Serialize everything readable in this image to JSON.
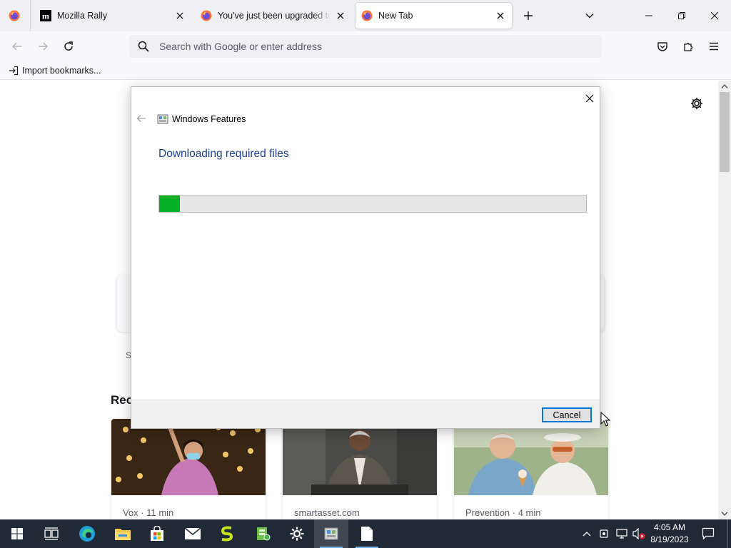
{
  "browser": {
    "tabs": [
      {
        "title": "Mozilla Rally",
        "favicon": "mozilla-m-icon",
        "active": false
      },
      {
        "title": "You've just been upgraded to F",
        "favicon": "firefox-icon",
        "active": false
      },
      {
        "title": "New Tab",
        "favicon": "firefox-icon",
        "active": true
      }
    ],
    "urlbar": {
      "placeholder": "Search with Google or enter address",
      "value": ""
    },
    "bookmarks": {
      "import_label": "Import bookmarks..."
    }
  },
  "newtab": {
    "recent_heading": "Rec",
    "partial_label": "S",
    "cards": [
      {
        "source": "Vox · 11 min",
        "image": "woman-in-mask-taking-photo"
      },
      {
        "source": "smartasset.com",
        "image": "elderly-man-in-suit"
      },
      {
        "source": "Prevention · 4 min",
        "image": "elderly-couple-with-ice-cream"
      }
    ]
  },
  "dialog": {
    "app_title": "Windows Features",
    "heading": "Downloading required files",
    "progress_fraction": 0.048,
    "cancel_label": "Cancel"
  },
  "taskbar": {
    "time": "4:05 AM",
    "date": "8/19/2023",
    "pinned": [
      "windows-start-icon",
      "task-view-icon",
      "edge-icon",
      "file-explorer-icon",
      "store-icon",
      "mail-icon",
      "sketchbook-icon",
      "green-app-icon",
      "settings-icon",
      "windows-features-icon",
      "notepad-icon"
    ]
  },
  "colors": {
    "dialog_heading": "#1c3f94",
    "progress_green": "#06b025",
    "focus_blue": "#0078d7",
    "taskbar_bg": "#1f2a36"
  }
}
